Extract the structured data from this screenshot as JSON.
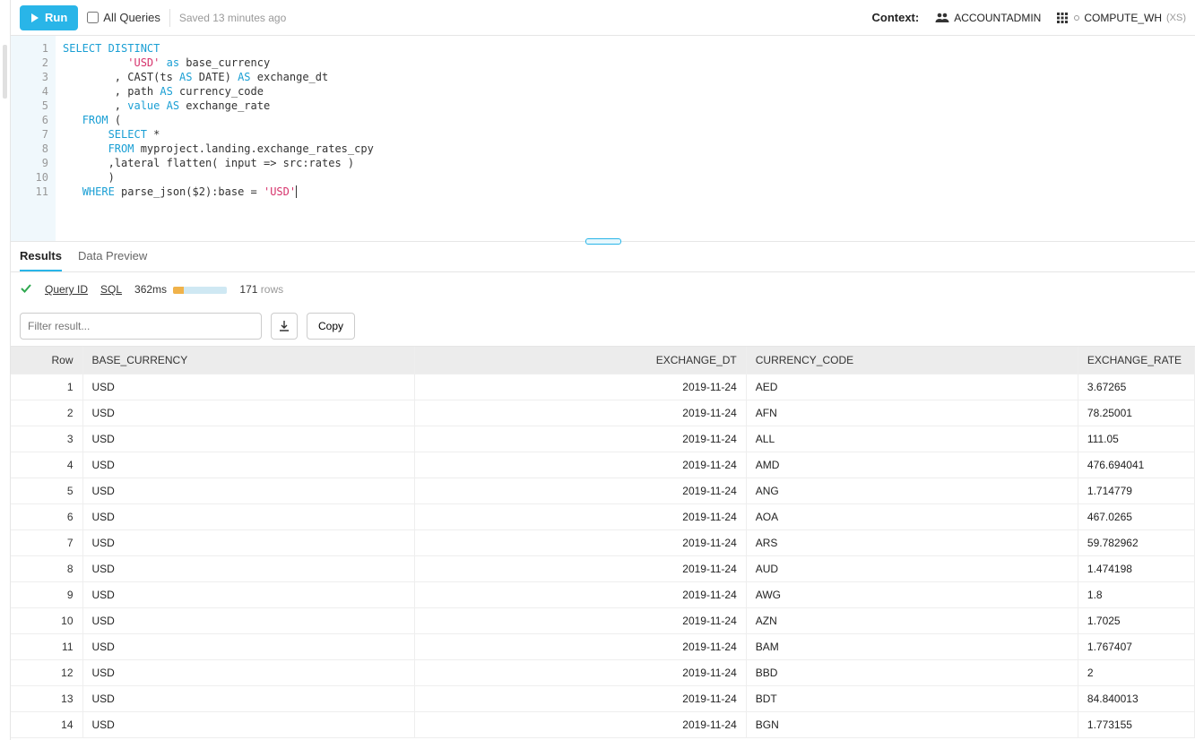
{
  "toolbar": {
    "run_label": "Run",
    "all_queries_label": "All Queries",
    "saved_text": "Saved 13 minutes ago",
    "context_label": "Context:",
    "role": "ACCOUNTADMIN",
    "warehouse": "COMPUTE_WH",
    "warehouse_size": "(XS)"
  },
  "editor": {
    "lines": [
      {
        "n": "1"
      },
      {
        "n": "2"
      },
      {
        "n": "3"
      },
      {
        "n": "4"
      },
      {
        "n": "5"
      },
      {
        "n": "6"
      },
      {
        "n": "7"
      },
      {
        "n": "8"
      },
      {
        "n": "9"
      },
      {
        "n": "10"
      },
      {
        "n": "11"
      }
    ],
    "tokens": {
      "l1_a": "SELECT DISTINCT",
      "l2_a": "'USD'",
      "l2_b": " as",
      "l2_c": " base_currency",
      "l3_a": ", CAST(ts ",
      "l3_b": "AS",
      "l3_c": " DATE) ",
      "l3_d": "AS",
      "l3_e": " exchange_dt",
      "l4_a": ", path ",
      "l4_b": "AS",
      "l4_c": " currency_code",
      "l5_a": ", ",
      "l5_b": "value AS",
      "l5_c": " exchange_rate",
      "l6_a": "FROM",
      "l6_b": " (",
      "l7_a": "SELECT",
      "l7_b": " *",
      "l8_a": "FROM",
      "l8_b": " myproject.landing.exchange_rates_cpy",
      "l9_a": ",lateral flatten( input => src:rates )",
      "l10_a": ")",
      "l11_a": "WHERE",
      "l11_b": " parse_json($2):base = ",
      "l11_c": "'USD'"
    }
  },
  "tabs": {
    "results": "Results",
    "preview": "Data Preview"
  },
  "status": {
    "query_id": "Query ID",
    "sql": "SQL",
    "time": "362ms",
    "rows_n": "171",
    "rows_label": "rows"
  },
  "controls": {
    "filter_placeholder": "Filter result...",
    "copy_label": "Copy"
  },
  "table": {
    "headers": {
      "row": "Row",
      "base": "BASE_CURRENCY",
      "dt": "EXCHANGE_DT",
      "code": "CURRENCY_CODE",
      "rate": "EXCHANGE_RATE"
    },
    "rows": [
      {
        "n": "1",
        "base": "USD",
        "dt": "2019-11-24",
        "code": "AED",
        "rate": "3.67265"
      },
      {
        "n": "2",
        "base": "USD",
        "dt": "2019-11-24",
        "code": "AFN",
        "rate": "78.25001"
      },
      {
        "n": "3",
        "base": "USD",
        "dt": "2019-11-24",
        "code": "ALL",
        "rate": "111.05"
      },
      {
        "n": "4",
        "base": "USD",
        "dt": "2019-11-24",
        "code": "AMD",
        "rate": "476.694041"
      },
      {
        "n": "5",
        "base": "USD",
        "dt": "2019-11-24",
        "code": "ANG",
        "rate": "1.714779"
      },
      {
        "n": "6",
        "base": "USD",
        "dt": "2019-11-24",
        "code": "AOA",
        "rate": "467.0265"
      },
      {
        "n": "7",
        "base": "USD",
        "dt": "2019-11-24",
        "code": "ARS",
        "rate": "59.782962"
      },
      {
        "n": "8",
        "base": "USD",
        "dt": "2019-11-24",
        "code": "AUD",
        "rate": "1.474198"
      },
      {
        "n": "9",
        "base": "USD",
        "dt": "2019-11-24",
        "code": "AWG",
        "rate": "1.8"
      },
      {
        "n": "10",
        "base": "USD",
        "dt": "2019-11-24",
        "code": "AZN",
        "rate": "1.7025"
      },
      {
        "n": "11",
        "base": "USD",
        "dt": "2019-11-24",
        "code": "BAM",
        "rate": "1.767407"
      },
      {
        "n": "12",
        "base": "USD",
        "dt": "2019-11-24",
        "code": "BBD",
        "rate": "2"
      },
      {
        "n": "13",
        "base": "USD",
        "dt": "2019-11-24",
        "code": "BDT",
        "rate": "84.840013"
      },
      {
        "n": "14",
        "base": "USD",
        "dt": "2019-11-24",
        "code": "BGN",
        "rate": "1.773155"
      }
    ]
  }
}
